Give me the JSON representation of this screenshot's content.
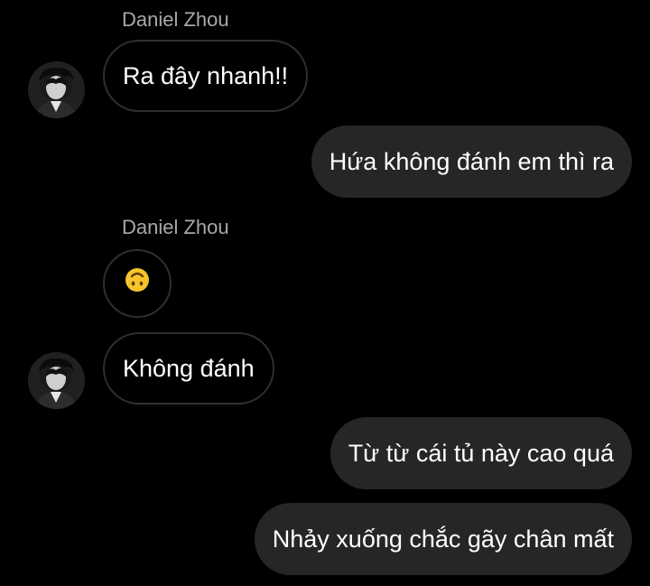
{
  "conversation": {
    "messages": [
      {
        "sender": "Daniel Zhou",
        "direction": "incoming",
        "text": "Ra đây nhanh!!"
      },
      {
        "direction": "outgoing",
        "text": "Hứa không đánh em thì ra"
      },
      {
        "sender": "Daniel Zhou",
        "direction": "incoming",
        "emoji": "upside-down-face"
      },
      {
        "direction": "incoming",
        "text": "Không đánh"
      },
      {
        "direction": "outgoing",
        "text": "Từ từ cái tủ này cao quá"
      },
      {
        "direction": "outgoing",
        "text": "Nhảy xuống chắc gãy chân mất"
      }
    ]
  },
  "colors": {
    "background": "#000000",
    "incoming_border": "#2f2f2f",
    "outgoing_bubble": "#262626",
    "sender_name": "#a8a8a8",
    "emoji_yellow": "#f7c52b"
  }
}
